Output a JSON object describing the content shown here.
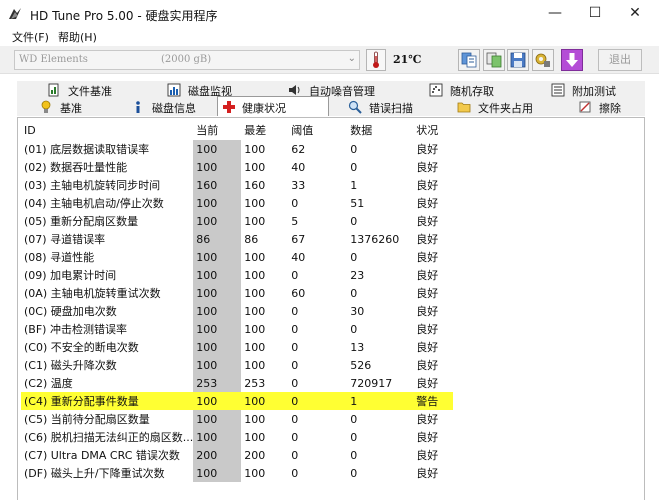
{
  "window": {
    "title": "HD Tune Pro 5.00 - 硬盘实用程序",
    "minimize_glyph": "—",
    "maximize_glyph": "☐",
    "close_glyph": "✕",
    "app_icon": "hdtune-logo-icon"
  },
  "menu": [
    "文件(F)",
    "帮助(H)"
  ],
  "toolbar": {
    "drive_name": "WD Elements",
    "drive_size": "(2000 gB)",
    "temperature": "21℃",
    "exit_label": "退出",
    "buttons": [
      "copy-info-icon",
      "copy-screenshot-icon",
      "save-icon",
      "options-icon",
      "download-icon"
    ],
    "accent_color": "#b44dd6"
  },
  "tabs_row1": [
    {
      "label": "文件基准",
      "icon": "file-benchmark-icon"
    },
    {
      "label": "磁盘监视",
      "icon": "disk-monitor-icon"
    },
    {
      "label": "自动噪音管理",
      "icon": "speaker-icon"
    },
    {
      "label": "随机存取",
      "icon": "random-access-icon"
    },
    {
      "label": "附加测试",
      "icon": "extra-tests-icon"
    }
  ],
  "tabs_row2": [
    {
      "label": "基准",
      "icon": "benchmark-icon"
    },
    {
      "label": "磁盘信息",
      "icon": "info-icon"
    },
    {
      "label": "健康状况",
      "icon": "health-icon",
      "active": true
    },
    {
      "label": "错误扫描",
      "icon": "error-scan-icon"
    },
    {
      "label": "文件夹占用",
      "icon": "folder-icon"
    },
    {
      "label": "擦除",
      "icon": "erase-icon"
    }
  ],
  "table": {
    "columns": [
      "ID",
      "当前",
      "最差",
      "阈值",
      "数据",
      "状况"
    ],
    "rows": [
      [
        "(01) 底层数据读取错误率",
        "100",
        "100",
        "62",
        "0",
        "良好"
      ],
      [
        "(02) 数据吞吐量性能",
        "100",
        "100",
        "40",
        "0",
        "良好"
      ],
      [
        "(03) 主轴电机旋转同步时间",
        "160",
        "160",
        "33",
        "1",
        "良好"
      ],
      [
        "(04) 主轴电机启动/停止次数",
        "100",
        "100",
        "0",
        "51",
        "良好"
      ],
      [
        "(05) 重新分配扇区数量",
        "100",
        "100",
        "5",
        "0",
        "良好"
      ],
      [
        "(07) 寻道错误率",
        "86",
        "86",
        "67",
        "1376260",
        "良好"
      ],
      [
        "(08) 寻道性能",
        "100",
        "100",
        "40",
        "0",
        "良好"
      ],
      [
        "(09) 加电累计时间",
        "100",
        "100",
        "0",
        "23",
        "良好"
      ],
      [
        "(0A) 主轴电机旋转重试次数",
        "100",
        "100",
        "60",
        "0",
        "良好"
      ],
      [
        "(0C) 硬盘加电次数",
        "100",
        "100",
        "0",
        "30",
        "良好"
      ],
      [
        "(BF) 冲击检测错误率",
        "100",
        "100",
        "0",
        "0",
        "良好"
      ],
      [
        "(C0) 不安全的断电次数",
        "100",
        "100",
        "0",
        "13",
        "良好"
      ],
      [
        "(C1) 磁头升降次数",
        "100",
        "100",
        "0",
        "526",
        "良好"
      ],
      [
        "(C2) 温度",
        "253",
        "253",
        "0",
        "720917",
        "良好"
      ],
      [
        "(C4) 重新分配事件数量",
        "100",
        "100",
        "0",
        "1",
        "警告"
      ],
      [
        "(C5) 当前待分配扇区数量",
        "100",
        "100",
        "0",
        "0",
        "良好"
      ],
      [
        "(C6) 脱机扫描无法纠正的扇区数...",
        "100",
        "100",
        "0",
        "0",
        "良好"
      ],
      [
        "(C7) Ultra DMA CRC 错误次数",
        "200",
        "200",
        "0",
        "0",
        "良好"
      ],
      [
        "(DF) 磁头上升/下降重试次数",
        "100",
        "100",
        "0",
        "0",
        "良好"
      ]
    ],
    "highlight_row": 14,
    "highlight_color": "#ffff33"
  }
}
